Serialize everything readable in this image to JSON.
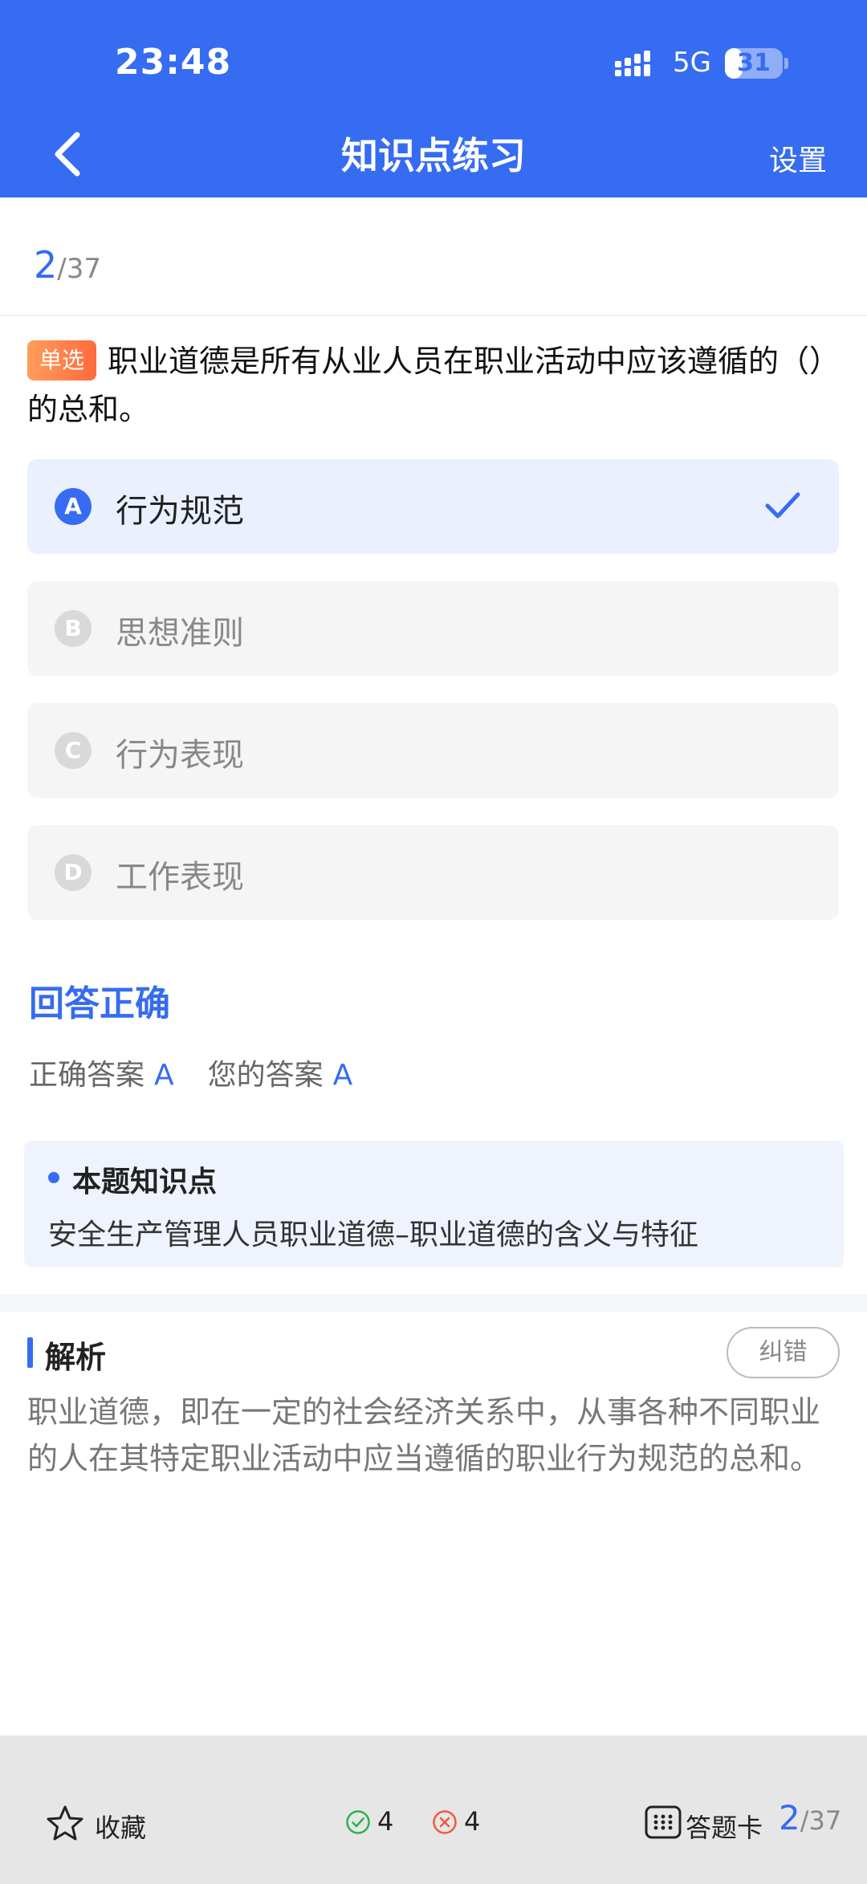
{
  "status_bar": {
    "time": "23:48",
    "network": "5G",
    "battery": "31",
    "battery_level": 0.31
  },
  "nav": {
    "back_icon": "chevron-left-icon",
    "title": "知识点练习",
    "settings": "设置"
  },
  "progress": {
    "current": "2",
    "total": "/37"
  },
  "question": {
    "type_tag": "单选",
    "text": "职业道德是所有从业人员在职业活动中应该遵循的（）的总和。"
  },
  "options": [
    {
      "letter": "A",
      "text": "行为规范",
      "selected": true
    },
    {
      "letter": "B",
      "text": "思想准则",
      "selected": false
    },
    {
      "letter": "C",
      "text": "行为表现",
      "selected": false
    },
    {
      "letter": "D",
      "text": "工作表现",
      "selected": false
    }
  ],
  "result": {
    "title": "回答正确",
    "correct_label": "正确答案",
    "correct_value": "A",
    "your_label": "您的答案",
    "your_value": "A"
  },
  "knowledge_point": {
    "title": "本题知识点",
    "text": "安全生产管理人员职业道德–职业道德的含义与特征"
  },
  "analysis": {
    "title": "解析",
    "report_button": "纠错",
    "text": "职业道德，即在一定的社会经济关系中，从事各种不同职业的人在其特定职业活动中应当遵循的职业行为规范的总和。"
  },
  "bottom_bar": {
    "favorite": "收藏",
    "correct_count": "4",
    "wrong_count": "4",
    "answer_card": "答题卡",
    "progress_current": "2",
    "progress_total": "/37"
  },
  "colors": {
    "accent": "#356cf1",
    "tag": "#ff7a45",
    "correct": "#2bb24c",
    "wrong": "#f05a3c"
  }
}
